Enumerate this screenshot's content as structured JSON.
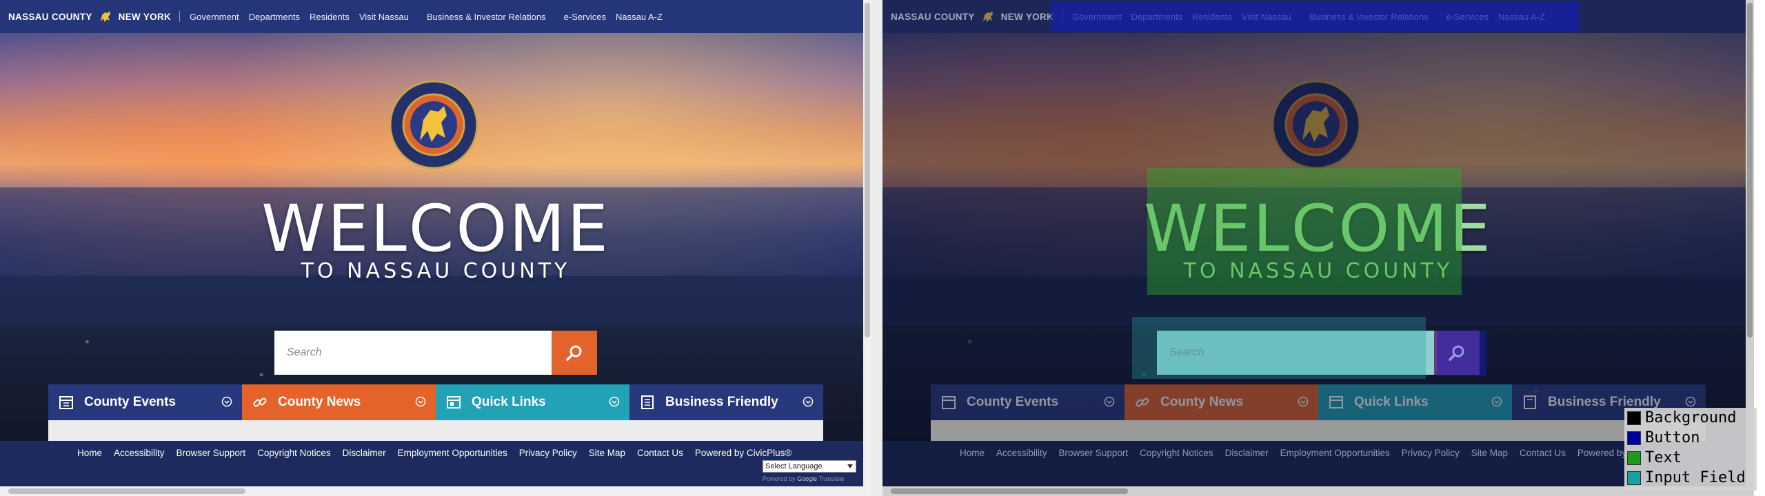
{
  "header": {
    "brand_left": "NASSAU COUNTY",
    "brand_right": "NEW YORK",
    "nav": [
      "Government",
      "Departments",
      "Residents",
      "Visit Nassau",
      "Business & Investor Relations",
      "e-Services",
      "Nassau A-Z"
    ]
  },
  "hero": {
    "welcome_title": "WELCOME",
    "welcome_sub": "TO NASSAU COUNTY"
  },
  "search": {
    "placeholder": "Search"
  },
  "tabs": [
    {
      "label": "County Events",
      "color": "#27387d"
    },
    {
      "label": "County News",
      "color": "#e4632a"
    },
    {
      "label": "Quick Links",
      "color": "#21a2b7"
    },
    {
      "label": "Business Friendly",
      "color": "#27387d"
    }
  ],
  "footer": {
    "links": [
      "Home",
      "Accessibility",
      "Browser Support",
      "Copyright Notices",
      "Disclaimer",
      "Employment Opportunities",
      "Privacy Policy",
      "Site Map",
      "Contact Us",
      "Powered by CivicPlus®"
    ],
    "language_select": "Select Language",
    "powered_prefix": "Powered by",
    "powered_google": "Google",
    "translate": "Translate"
  },
  "legend": [
    {
      "label": "Background",
      "color": "#000000"
    },
    {
      "label": "Button",
      "color": "#0000a0"
    },
    {
      "label": "Text",
      "color": "#1f9a1f"
    },
    {
      "label": "Input Field",
      "color": "#1fa0a0"
    }
  ]
}
